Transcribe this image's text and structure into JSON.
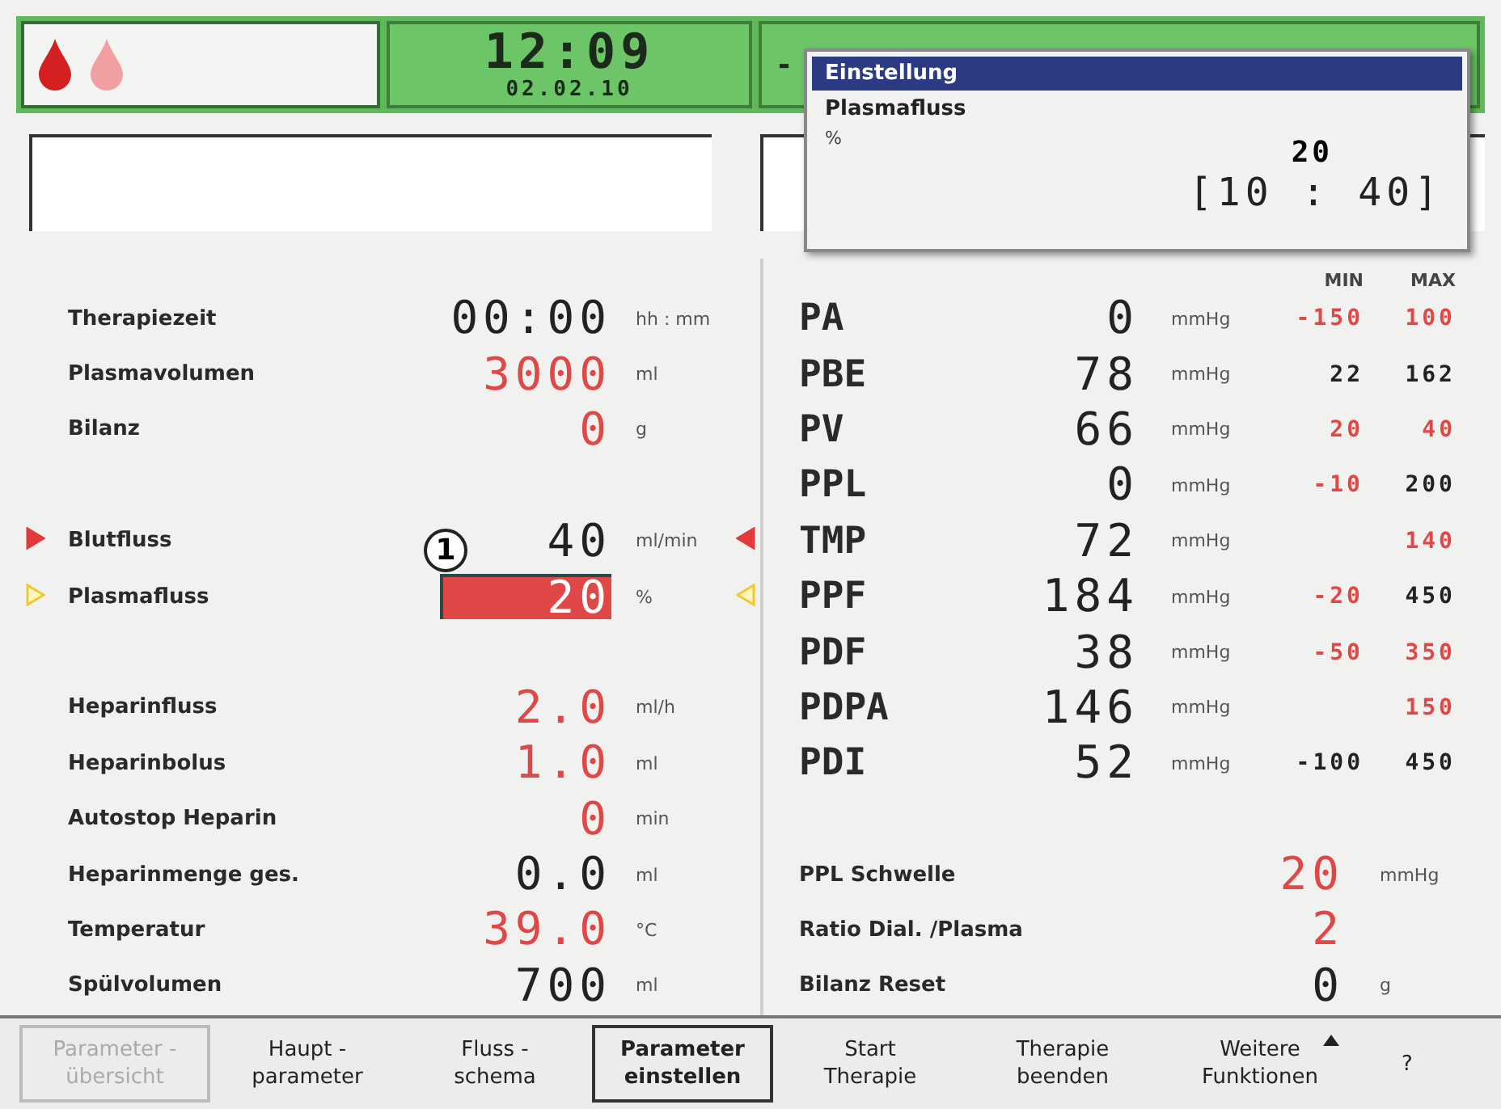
{
  "status_bar": {
    "drops": [
      {
        "color": "#d42020"
      },
      {
        "color": "#f0a0a0"
      }
    ],
    "time": "12:09",
    "date": "02.02.10",
    "message_mark": "-"
  },
  "dialog": {
    "title": "Einstellung",
    "parameter": "Plasmafluss",
    "unit": "%",
    "value": "20",
    "range": "[10 : 40]"
  },
  "left_panel": {
    "groups": [
      [
        {
          "label": "Therapiezeit",
          "value": "00:00",
          "unit": "hh : mm",
          "color": "#222222",
          "selected": false
        },
        {
          "label": "Plasmavolumen",
          "value": "3000",
          "unit": "ml",
          "color": "#e04848",
          "selected": false
        },
        {
          "label": "Bilanz",
          "value": "0",
          "unit": "g",
          "color": "#e04848",
          "selected": false
        }
      ],
      [
        {
          "label": "Blutfluss",
          "value": "40",
          "unit": "ml/min",
          "color": "#222222",
          "selected": false,
          "indicator": {
            "color": "#e03a3a",
            "filled": true
          }
        },
        {
          "label": "Plasmafluss",
          "value": "20",
          "unit": "%",
          "color": "#e04848",
          "selected": true,
          "callout": "1",
          "indicator": {
            "color": "#f0c830",
            "filled": false
          }
        }
      ],
      [
        {
          "label": "Heparinfluss",
          "value": "2.0",
          "unit": "ml/h",
          "color": "#e04848",
          "selected": false
        },
        {
          "label": "Heparinbolus",
          "value": "1.0",
          "unit": "ml",
          "color": "#e04848",
          "selected": false
        },
        {
          "label": "Autostop Heparin",
          "value": "0",
          "unit": "min",
          "color": "#e04848",
          "selected": false
        },
        {
          "label": "Heparinmenge ges.",
          "value": "0.0",
          "unit": "ml",
          "color": "#222222",
          "selected": false
        },
        {
          "label": "Temperatur",
          "value": "39.0",
          "unit": "°C",
          "color": "#e04848",
          "selected": false
        },
        {
          "label": "Spülvolumen",
          "value": "700",
          "unit": "ml",
          "color": "#222222",
          "selected": false
        }
      ]
    ]
  },
  "right_panel": {
    "limit_headers": [
      "MIN",
      "MAX"
    ],
    "pressures": [
      {
        "name": "PA",
        "value": "0",
        "unit": "mmHg",
        "min": {
          "text": "-150",
          "color": "#e04848"
        },
        "max": {
          "text": "100",
          "color": "#e04848"
        }
      },
      {
        "name": "PBE",
        "value": "78",
        "unit": "mmHg",
        "min": {
          "text": "22",
          "color": "#222222"
        },
        "max": {
          "text": "162",
          "color": "#222222"
        }
      },
      {
        "name": "PV",
        "value": "66",
        "unit": "mmHg",
        "min": {
          "text": "20",
          "color": "#e04848"
        },
        "max": {
          "text": "40",
          "color": "#e04848"
        }
      },
      {
        "name": "PPL",
        "value": "0",
        "unit": "mmHg",
        "min": {
          "text": "-10",
          "color": "#e04848"
        },
        "max": {
          "text": "200",
          "color": "#222222"
        }
      },
      {
        "name": "TMP",
        "value": "72",
        "unit": "mmHg",
        "max": {
          "text": "140",
          "color": "#e04848"
        }
      },
      {
        "name": "PPF",
        "value": "184",
        "unit": "mmHg",
        "min": {
          "text": "-20",
          "color": "#e04848"
        },
        "max": {
          "text": "450",
          "color": "#222222"
        }
      },
      {
        "name": "PDF",
        "value": "38",
        "unit": "mmHg",
        "min": {
          "text": "-50",
          "color": "#e04848"
        },
        "max": {
          "text": "350",
          "color": "#e04848"
        }
      },
      {
        "name": "PDPA",
        "value": "146",
        "unit": "mmHg",
        "max": {
          "text": "150",
          "color": "#e04848"
        }
      },
      {
        "name": "PDI",
        "value": "52",
        "unit": "mmHg",
        "min": {
          "text": "-100",
          "color": "#222222"
        },
        "max": {
          "text": "450",
          "color": "#222222"
        }
      }
    ],
    "settings": [
      {
        "label": "PPL Schwelle",
        "value": "20",
        "unit": "mmHg",
        "color": "#e04848"
      },
      {
        "label": "Ratio Dial. /Plasma",
        "value": "2",
        "color": "#e04848"
      },
      {
        "label": "Bilanz Reset",
        "value": "0",
        "unit": "g",
        "color": "#222222"
      }
    ]
  },
  "footer_buttons": [
    {
      "label": "Parameter -\nübersicht",
      "disabled": true,
      "selected": false,
      "submenu": false
    },
    {
      "label": "Haupt -\nparameter",
      "disabled": false,
      "selected": false,
      "submenu": false
    },
    {
      "label": "Fluss -\nschema",
      "disabled": false,
      "selected": false,
      "submenu": false
    },
    {
      "label": "Parameter\neinstellen",
      "disabled": false,
      "selected": true,
      "submenu": false
    },
    {
      "label": "Start\nTherapie",
      "disabled": false,
      "selected": false,
      "submenu": false
    },
    {
      "label": "Therapie\nbeenden",
      "disabled": false,
      "selected": false,
      "submenu": false
    },
    {
      "label": "Weitere\nFunktionen",
      "disabled": false,
      "selected": false,
      "submenu": true
    },
    {
      "label": "?",
      "disabled": false,
      "selected": false,
      "submenu": false
    }
  ]
}
